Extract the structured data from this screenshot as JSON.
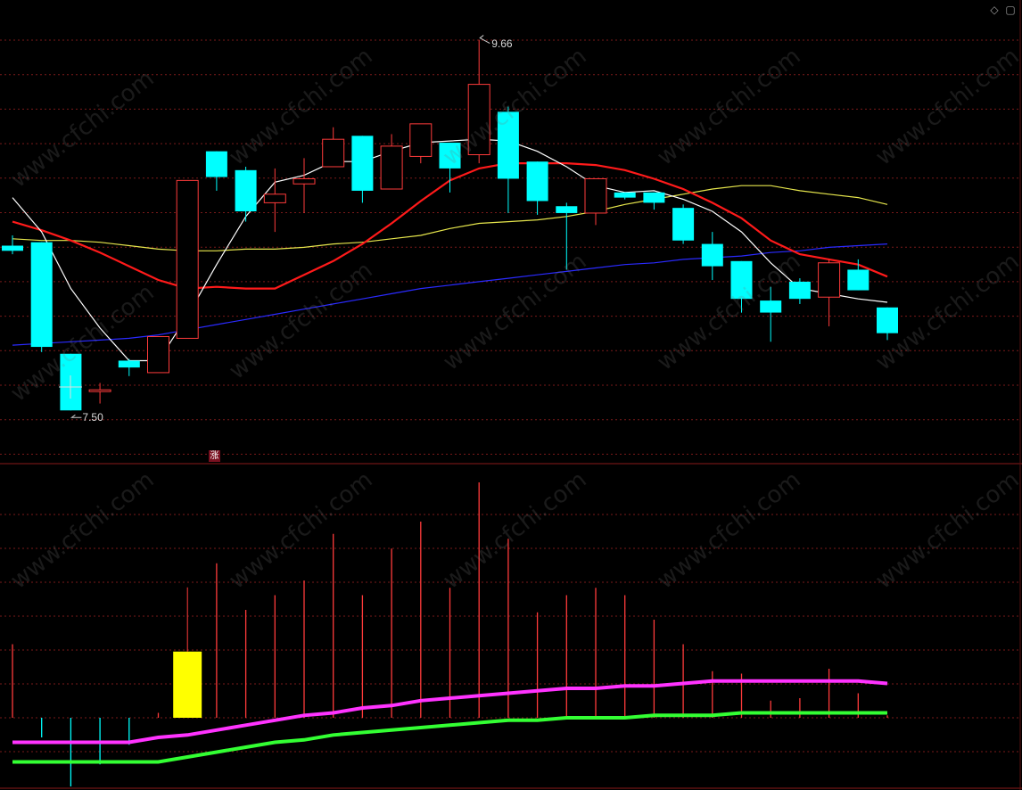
{
  "toolbar": {
    "diamond_icon": "◇",
    "square_icon": "▢"
  },
  "annotations": {
    "high_label": "9.66",
    "low_label": "7.50",
    "zhang_mark": "涨"
  },
  "watermark": "www.cfchi.com",
  "colors": {
    "up": "#ff3b3b",
    "down": "#00ffff",
    "ma5": "#ffffff",
    "ma10": "#ff1a1a",
    "ma20": "#e6e64c",
    "ma60": "#2a2aff",
    "vol_ma1": "#ff33ff",
    "vol_ma2": "#33ff33",
    "highlight_volume": "#ffff00",
    "grid": "#7a1a1a",
    "divider": "#8a1a1a"
  },
  "chart_data": [
    {
      "type": "candlestick",
      "ylim": [
        7.2,
        9.85
      ],
      "candles": [
        {
          "o": 8.46,
          "h": 8.52,
          "l": 8.41,
          "c": 8.43
        },
        {
          "o": 8.48,
          "h": 8.48,
          "l": 7.84,
          "c": 7.87
        },
        {
          "o": 7.83,
          "h": 7.83,
          "l": 7.5,
          "c": 7.5
        },
        {
          "o": 7.61,
          "h": 7.66,
          "l": 7.54,
          "c": 7.62
        },
        {
          "o": 7.79,
          "h": 7.8,
          "l": 7.7,
          "c": 7.75
        },
        {
          "o": 7.72,
          "h": 7.93,
          "l": 7.72,
          "c": 7.93
        },
        {
          "o": 7.92,
          "h": 8.84,
          "l": 7.92,
          "c": 8.84
        },
        {
          "o": 9.01,
          "h": 9.01,
          "l": 8.78,
          "c": 8.86
        },
        {
          "o": 8.9,
          "h": 8.92,
          "l": 8.6,
          "c": 8.66
        },
        {
          "o": 8.71,
          "h": 8.91,
          "l": 8.54,
          "c": 8.76
        },
        {
          "o": 8.82,
          "h": 8.97,
          "l": 8.65,
          "c": 8.85
        },
        {
          "o": 8.92,
          "h": 9.15,
          "l": 8.92,
          "c": 9.08
        },
        {
          "o": 9.1,
          "h": 9.1,
          "l": 8.71,
          "c": 8.78
        },
        {
          "o": 8.79,
          "h": 9.11,
          "l": 8.79,
          "c": 9.04
        },
        {
          "o": 8.98,
          "h": 9.17,
          "l": 8.94,
          "c": 9.17
        },
        {
          "o": 9.06,
          "h": 9.06,
          "l": 8.77,
          "c": 8.91
        },
        {
          "o": 8.99,
          "h": 9.66,
          "l": 8.94,
          "c": 9.4
        },
        {
          "o": 9.24,
          "h": 9.27,
          "l": 8.65,
          "c": 8.85
        },
        {
          "o": 8.95,
          "h": 8.95,
          "l": 8.64,
          "c": 8.72
        },
        {
          "o": 8.69,
          "h": 8.71,
          "l": 8.32,
          "c": 8.65
        },
        {
          "o": 8.65,
          "h": 8.85,
          "l": 8.58,
          "c": 8.85
        },
        {
          "o": 8.77,
          "h": 8.77,
          "l": 8.73,
          "c": 8.74
        },
        {
          "o": 8.77,
          "h": 8.77,
          "l": 8.67,
          "c": 8.71
        },
        {
          "o": 8.68,
          "h": 8.7,
          "l": 8.47,
          "c": 8.49
        },
        {
          "o": 8.47,
          "h": 8.54,
          "l": 8.26,
          "c": 8.34
        },
        {
          "o": 8.37,
          "h": 8.37,
          "l": 8.07,
          "c": 8.15
        },
        {
          "o": 8.14,
          "h": 8.22,
          "l": 7.9,
          "c": 8.07
        },
        {
          "o": 8.25,
          "h": 8.27,
          "l": 8.12,
          "c": 8.15
        },
        {
          "o": 8.16,
          "h": 8.38,
          "l": 7.99,
          "c": 8.36
        },
        {
          "o": 8.32,
          "h": 8.38,
          "l": 8.2,
          "c": 8.2
        },
        {
          "o": 8.1,
          "h": 8.1,
          "l": 7.91,
          "c": 7.95
        }
      ],
      "ma5": [
        8.74,
        8.54,
        8.21,
        7.98,
        7.79,
        7.79,
        8.05,
        8.35,
        8.63,
        8.83,
        8.87,
        8.95,
        8.95,
        9.01,
        9.06,
        9.07,
        9.08,
        9.07,
        9.01,
        8.92,
        8.81,
        8.77,
        8.78,
        8.73,
        8.66,
        8.54,
        8.36,
        8.21,
        8.18,
        8.15,
        8.13
      ],
      "ma10": [
        8.6,
        8.55,
        8.49,
        8.42,
        8.34,
        8.26,
        8.21,
        8.22,
        8.21,
        8.21,
        8.29,
        8.37,
        8.47,
        8.59,
        8.72,
        8.84,
        8.91,
        8.94,
        8.94,
        8.94,
        8.93,
        8.9,
        8.85,
        8.79,
        8.71,
        8.62,
        8.49,
        8.41,
        8.38,
        8.35,
        8.28
      ],
      "ma20": [
        8.5,
        8.49,
        8.49,
        8.48,
        8.46,
        8.44,
        8.43,
        8.43,
        8.44,
        8.44,
        8.45,
        8.47,
        8.48,
        8.5,
        8.52,
        8.56,
        8.59,
        8.6,
        8.61,
        8.63,
        8.66,
        8.7,
        8.73,
        8.76,
        8.79,
        8.81,
        8.81,
        8.78,
        8.76,
        8.74,
        8.7
      ],
      "ma60": [
        7.88,
        7.89,
        7.9,
        7.91,
        7.92,
        7.94,
        7.97,
        8.0,
        8.03,
        8.06,
        8.09,
        8.12,
        8.15,
        8.18,
        8.21,
        8.23,
        8.25,
        8.27,
        8.29,
        8.31,
        8.33,
        8.35,
        8.36,
        8.38,
        8.39,
        8.4,
        8.42,
        8.43,
        8.45,
        8.46,
        8.47
      ]
    },
    {
      "type": "bar",
      "ylim": [
        -0.28,
        1.0
      ],
      "values": [
        0.3,
        -0.08,
        -0.28,
        -0.19,
        -0.11,
        0.02,
        0.27,
        0.63,
        0.44,
        0.5,
        0.56,
        0.75,
        0.5,
        0.69,
        0.8,
        0.53,
        0.96,
        0.73,
        0.43,
        0.5,
        0.53,
        0.5,
        0.4,
        0.3,
        0.19,
        0.18,
        0.07,
        0.08,
        0.2,
        0.1,
        0.01
      ],
      "highlight_index": 6,
      "ma_fast": [
        -0.1,
        -0.1,
        -0.1,
        -0.1,
        -0.1,
        -0.08,
        -0.07,
        -0.05,
        -0.03,
        -0.01,
        0.01,
        0.02,
        0.04,
        0.05,
        0.07,
        0.08,
        0.09,
        0.1,
        0.11,
        0.12,
        0.12,
        0.13,
        0.13,
        0.14,
        0.15,
        0.15,
        0.15,
        0.15,
        0.15,
        0.15,
        0.14
      ],
      "ma_slow": [
        -0.18,
        -0.18,
        -0.18,
        -0.18,
        -0.18,
        -0.18,
        -0.16,
        -0.14,
        -0.12,
        -0.1,
        -0.09,
        -0.07,
        -0.06,
        -0.05,
        -0.04,
        -0.03,
        -0.02,
        -0.01,
        -0.01,
        0.0,
        0.0,
        0.0,
        0.01,
        0.01,
        0.01,
        0.02,
        0.02,
        0.02,
        0.02,
        0.02,
        0.02
      ]
    }
  ]
}
